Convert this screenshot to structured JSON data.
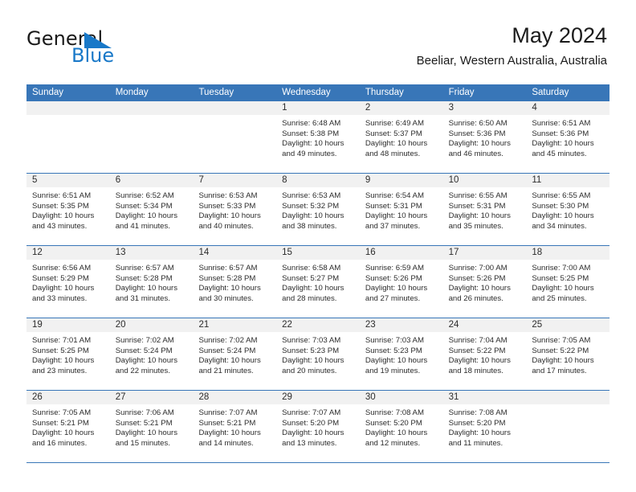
{
  "brand": {
    "word_general": "General",
    "word_blue": "Blue",
    "flag_icon": "blue-flag-triangle-icon",
    "accent_color": "#1878c8"
  },
  "header": {
    "title": "May 2024",
    "subtitle": "Beeliar, Western Australia, Australia"
  },
  "theme": {
    "header_blue": "#3876b8",
    "day_band_gray": "#f1f1f1",
    "text_color": "#2c2c2c"
  },
  "weekdays": [
    "Sunday",
    "Monday",
    "Tuesday",
    "Wednesday",
    "Thursday",
    "Friday",
    "Saturday"
  ],
  "weeks": [
    [
      {
        "day": "",
        "empty": true
      },
      {
        "day": "",
        "empty": true
      },
      {
        "day": "",
        "empty": true
      },
      {
        "day": "1",
        "sunrise": "Sunrise: 6:48 AM",
        "sunset": "Sunset: 5:38 PM",
        "daylight": "Daylight: 10 hours and 49 minutes."
      },
      {
        "day": "2",
        "sunrise": "Sunrise: 6:49 AM",
        "sunset": "Sunset: 5:37 PM",
        "daylight": "Daylight: 10 hours and 48 minutes."
      },
      {
        "day": "3",
        "sunrise": "Sunrise: 6:50 AM",
        "sunset": "Sunset: 5:36 PM",
        "daylight": "Daylight: 10 hours and 46 minutes."
      },
      {
        "day": "4",
        "sunrise": "Sunrise: 6:51 AM",
        "sunset": "Sunset: 5:36 PM",
        "daylight": "Daylight: 10 hours and 45 minutes."
      }
    ],
    [
      {
        "day": "5",
        "sunrise": "Sunrise: 6:51 AM",
        "sunset": "Sunset: 5:35 PM",
        "daylight": "Daylight: 10 hours and 43 minutes."
      },
      {
        "day": "6",
        "sunrise": "Sunrise: 6:52 AM",
        "sunset": "Sunset: 5:34 PM",
        "daylight": "Daylight: 10 hours and 41 minutes."
      },
      {
        "day": "7",
        "sunrise": "Sunrise: 6:53 AM",
        "sunset": "Sunset: 5:33 PM",
        "daylight": "Daylight: 10 hours and 40 minutes."
      },
      {
        "day": "8",
        "sunrise": "Sunrise: 6:53 AM",
        "sunset": "Sunset: 5:32 PM",
        "daylight": "Daylight: 10 hours and 38 minutes."
      },
      {
        "day": "9",
        "sunrise": "Sunrise: 6:54 AM",
        "sunset": "Sunset: 5:31 PM",
        "daylight": "Daylight: 10 hours and 37 minutes."
      },
      {
        "day": "10",
        "sunrise": "Sunrise: 6:55 AM",
        "sunset": "Sunset: 5:31 PM",
        "daylight": "Daylight: 10 hours and 35 minutes."
      },
      {
        "day": "11",
        "sunrise": "Sunrise: 6:55 AM",
        "sunset": "Sunset: 5:30 PM",
        "daylight": "Daylight: 10 hours and 34 minutes."
      }
    ],
    [
      {
        "day": "12",
        "sunrise": "Sunrise: 6:56 AM",
        "sunset": "Sunset: 5:29 PM",
        "daylight": "Daylight: 10 hours and 33 minutes."
      },
      {
        "day": "13",
        "sunrise": "Sunrise: 6:57 AM",
        "sunset": "Sunset: 5:28 PM",
        "daylight": "Daylight: 10 hours and 31 minutes."
      },
      {
        "day": "14",
        "sunrise": "Sunrise: 6:57 AM",
        "sunset": "Sunset: 5:28 PM",
        "daylight": "Daylight: 10 hours and 30 minutes."
      },
      {
        "day": "15",
        "sunrise": "Sunrise: 6:58 AM",
        "sunset": "Sunset: 5:27 PM",
        "daylight": "Daylight: 10 hours and 28 minutes."
      },
      {
        "day": "16",
        "sunrise": "Sunrise: 6:59 AM",
        "sunset": "Sunset: 5:26 PM",
        "daylight": "Daylight: 10 hours and 27 minutes."
      },
      {
        "day": "17",
        "sunrise": "Sunrise: 7:00 AM",
        "sunset": "Sunset: 5:26 PM",
        "daylight": "Daylight: 10 hours and 26 minutes."
      },
      {
        "day": "18",
        "sunrise": "Sunrise: 7:00 AM",
        "sunset": "Sunset: 5:25 PM",
        "daylight": "Daylight: 10 hours and 25 minutes."
      }
    ],
    [
      {
        "day": "19",
        "sunrise": "Sunrise: 7:01 AM",
        "sunset": "Sunset: 5:25 PM",
        "daylight": "Daylight: 10 hours and 23 minutes."
      },
      {
        "day": "20",
        "sunrise": "Sunrise: 7:02 AM",
        "sunset": "Sunset: 5:24 PM",
        "daylight": "Daylight: 10 hours and 22 minutes."
      },
      {
        "day": "21",
        "sunrise": "Sunrise: 7:02 AM",
        "sunset": "Sunset: 5:24 PM",
        "daylight": "Daylight: 10 hours and 21 minutes."
      },
      {
        "day": "22",
        "sunrise": "Sunrise: 7:03 AM",
        "sunset": "Sunset: 5:23 PM",
        "daylight": "Daylight: 10 hours and 20 minutes."
      },
      {
        "day": "23",
        "sunrise": "Sunrise: 7:03 AM",
        "sunset": "Sunset: 5:23 PM",
        "daylight": "Daylight: 10 hours and 19 minutes."
      },
      {
        "day": "24",
        "sunrise": "Sunrise: 7:04 AM",
        "sunset": "Sunset: 5:22 PM",
        "daylight": "Daylight: 10 hours and 18 minutes."
      },
      {
        "day": "25",
        "sunrise": "Sunrise: 7:05 AM",
        "sunset": "Sunset: 5:22 PM",
        "daylight": "Daylight: 10 hours and 17 minutes."
      }
    ],
    [
      {
        "day": "26",
        "sunrise": "Sunrise: 7:05 AM",
        "sunset": "Sunset: 5:21 PM",
        "daylight": "Daylight: 10 hours and 16 minutes."
      },
      {
        "day": "27",
        "sunrise": "Sunrise: 7:06 AM",
        "sunset": "Sunset: 5:21 PM",
        "daylight": "Daylight: 10 hours and 15 minutes."
      },
      {
        "day": "28",
        "sunrise": "Sunrise: 7:07 AM",
        "sunset": "Sunset: 5:21 PM",
        "daylight": "Daylight: 10 hours and 14 minutes."
      },
      {
        "day": "29",
        "sunrise": "Sunrise: 7:07 AM",
        "sunset": "Sunset: 5:20 PM",
        "daylight": "Daylight: 10 hours and 13 minutes."
      },
      {
        "day": "30",
        "sunrise": "Sunrise: 7:08 AM",
        "sunset": "Sunset: 5:20 PM",
        "daylight": "Daylight: 10 hours and 12 minutes."
      },
      {
        "day": "31",
        "sunrise": "Sunrise: 7:08 AM",
        "sunset": "Sunset: 5:20 PM",
        "daylight": "Daylight: 10 hours and 11 minutes."
      },
      {
        "day": "",
        "empty": true
      }
    ]
  ]
}
